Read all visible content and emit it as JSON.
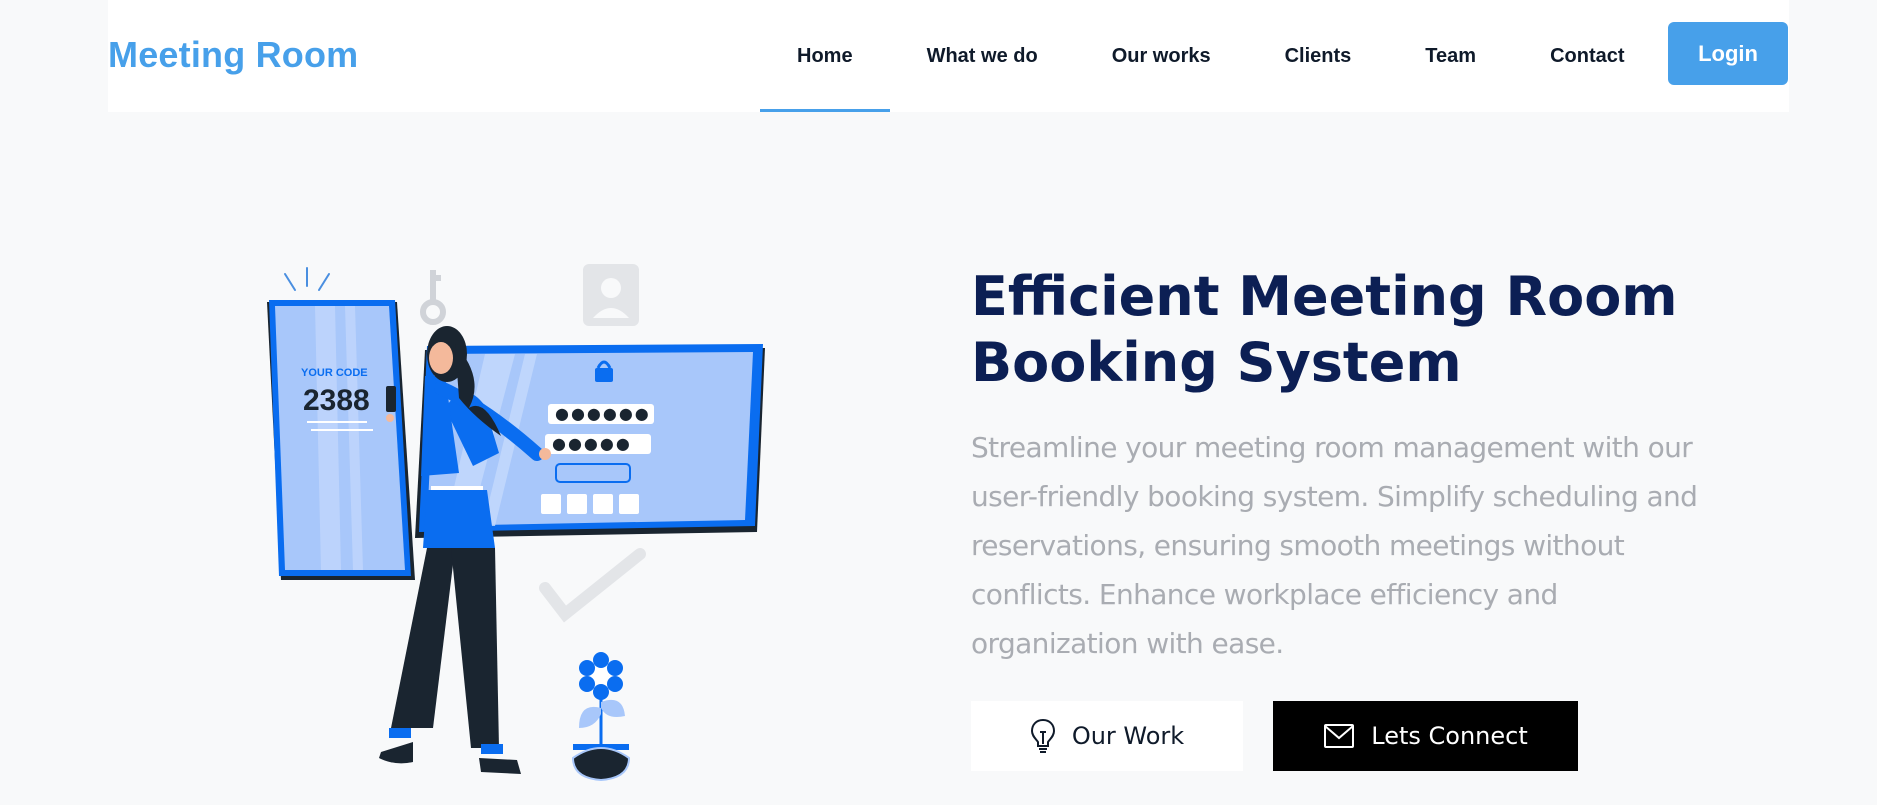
{
  "brand": {
    "name": "Meeting Room",
    "color": "#47a0ea"
  },
  "nav": {
    "items": [
      {
        "label": "Home",
        "active": true
      },
      {
        "label": "What we do"
      },
      {
        "label": "Our works"
      },
      {
        "label": "Clients"
      },
      {
        "label": "Team"
      },
      {
        "label": "Contact"
      }
    ],
    "login_label": "Login"
  },
  "hero": {
    "title_line1": "Efficient Meeting Room",
    "title_line2": "Booking System",
    "description": "Streamline your meeting room management with our user-friendly booking system. Simplify scheduling and reservations, ensuring smooth meetings without conflicts. Enhance workplace efficiency and organization with ease.",
    "illustration": {
      "code_label": "YOUR CODE",
      "code_value": "2388"
    },
    "buttons": {
      "work": {
        "label": "Our Work",
        "icon": "lightbulb-icon"
      },
      "connect": {
        "label": "Lets Connect",
        "icon": "envelope-icon"
      }
    }
  },
  "colors": {
    "accent": "#47a0ea",
    "title": "#0c1f54",
    "muted_text": "#a9acb2",
    "illustration_blue": "#0a6df0"
  }
}
